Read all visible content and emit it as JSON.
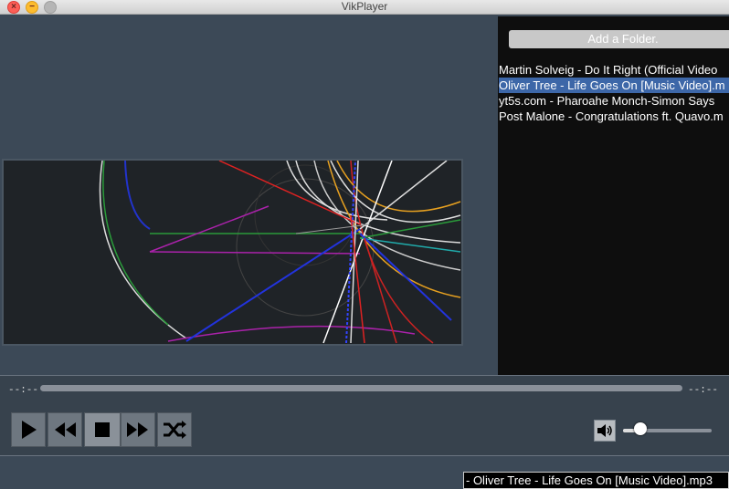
{
  "window": {
    "title": "VikPlayer",
    "controls": {
      "close_glyph": "×",
      "minimize_glyph": "−"
    }
  },
  "playlist": {
    "add_folder_label": "Add a Folder.",
    "items": [
      {
        "label": "Martin Solveig - Do It Right (Official Video",
        "selected": false
      },
      {
        "label": "Oliver Tree - Life Goes On [Music Video].m",
        "selected": true
      },
      {
        "label": "yt5s.com - Pharoahe Monch-Simon Says",
        "selected": false
      },
      {
        "label": "Post Malone - Congratulations ft. Quavo.m",
        "selected": false
      }
    ]
  },
  "transport": {
    "elapsed": "--:--",
    "remaining": "--:--",
    "progress_fraction": 0,
    "buttons": [
      "play-icon",
      "rewind-icon",
      "stop-icon",
      "fast-forward-icon",
      "shuffle-icon"
    ]
  },
  "volume": {
    "icon": "speaker-icon",
    "level_fraction": 0.2
  },
  "status": {
    "now_playing": "- Oliver Tree - Life Goes On [Music Video].mp3"
  },
  "colors": {
    "background": "#3c4957",
    "selection": "#3d67a8",
    "playlist_bg": "#0e0e0e"
  }
}
